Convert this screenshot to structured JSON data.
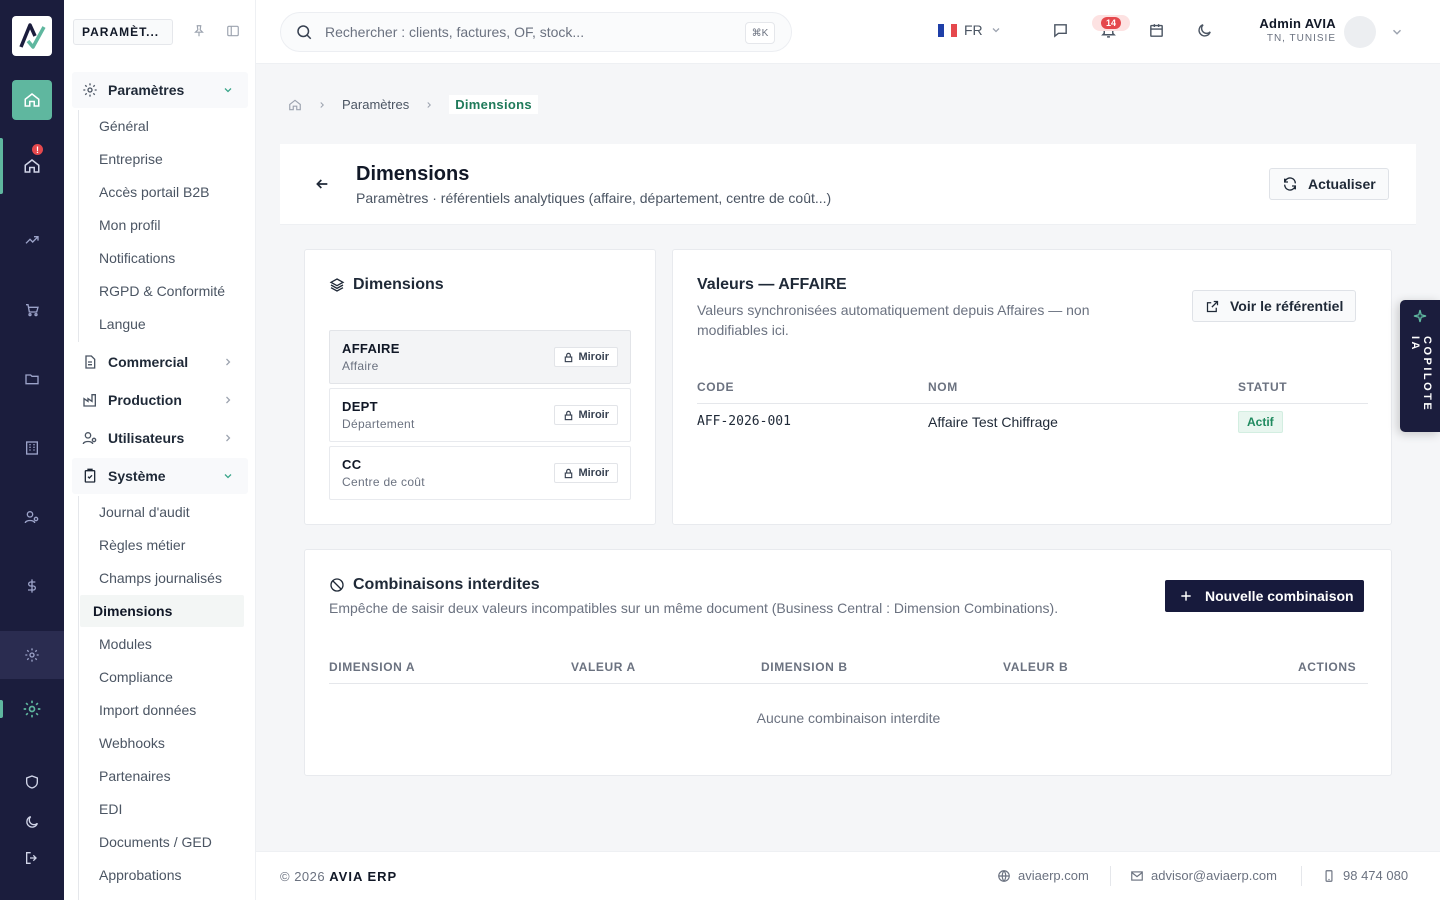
{
  "rail": {
    "notification_count": "!",
    "items": [
      "home-icon",
      "home-alert-icon",
      "trending-icon",
      "cart-icon",
      "folder-icon",
      "building-icon",
      "users-icon",
      "dollar-icon",
      "gear-icon",
      "gear-active-icon",
      "shield-icon",
      "moon-icon",
      "logout-icon"
    ]
  },
  "sidebar": {
    "header": "PARAMÈT...",
    "groups": {
      "parametres": "Paramètres",
      "commercial": "Commercial",
      "production": "Production",
      "utilisateurs": "Utilisateurs",
      "systeme": "Système"
    },
    "parametres_items": [
      "Général",
      "Entreprise",
      "Accès portail B2B",
      "Mon profil",
      "Notifications",
      "RGPD & Conformité",
      "Langue"
    ],
    "systeme_items": [
      "Journal d'audit",
      "Règles métier",
      "Champs journalisés",
      "Dimensions",
      "Modules",
      "Compliance",
      "Import données",
      "Webhooks",
      "Partenaires",
      "EDI",
      "Documents / GED",
      "Approbations"
    ]
  },
  "topbar": {
    "search_placeholder": "Rechercher : clients, factures, OF, stock...",
    "shortcut": "⌘K",
    "language": "FR",
    "notif_count": "14",
    "user_name": "Admin AVIA",
    "user_region": "TN, TUNISIE"
  },
  "breadcrumb": {
    "parent": "Paramètres",
    "current": "Dimensions"
  },
  "page": {
    "title": "Dimensions",
    "subtitle": "Paramètres · référentiels analytiques (affaire, département, centre de coût...)",
    "refresh_label": "Actualiser"
  },
  "dimensions_card": {
    "title": "Dimensions",
    "items": [
      {
        "code": "AFFAIRE",
        "label": "Affaire",
        "badge": "Miroir"
      },
      {
        "code": "DEPT",
        "label": "Département",
        "badge": "Miroir"
      },
      {
        "code": "CC",
        "label": "Centre de coût",
        "badge": "Miroir"
      }
    ]
  },
  "values_card": {
    "title": "Valeurs — AFFAIRE",
    "desc_line1": "Valeurs synchronisées automatiquement depuis Affaires — non",
    "desc_line2": "modifiables ici.",
    "link_label": "Voir le référentiel",
    "columns": [
      "CODE",
      "NOM",
      "STATUT"
    ],
    "rows": [
      {
        "code": "AFF-2026-001",
        "nom": "Affaire Test Chiffrage",
        "statut": "Actif"
      }
    ]
  },
  "combos_card": {
    "title": "Combinaisons interdites",
    "desc": "Empêche de saisir deux valeurs incompatibles sur un même document (Business Central : Dimension Combinations).",
    "button": "Nouvelle combinaison",
    "columns": [
      "DIMENSION A",
      "VALEUR A",
      "DIMENSION B",
      "VALEUR B",
      "ACTIONS"
    ],
    "empty": "Aucune combinaison interdite"
  },
  "copilot": {
    "label": "COPILOTE IA"
  },
  "footer": {
    "copyright": "© 2026",
    "brand": "AVIA ERP",
    "website": "aviaerp.com",
    "email": "advisor@aviaerp.com",
    "phone": "98 474 080"
  },
  "colors": {
    "rail_bg": "#1b1d3d",
    "accent": "#5fb79f",
    "active_text": "#1f7a5a",
    "danger": "#e5484d",
    "primary_dark": "#171a3c"
  }
}
